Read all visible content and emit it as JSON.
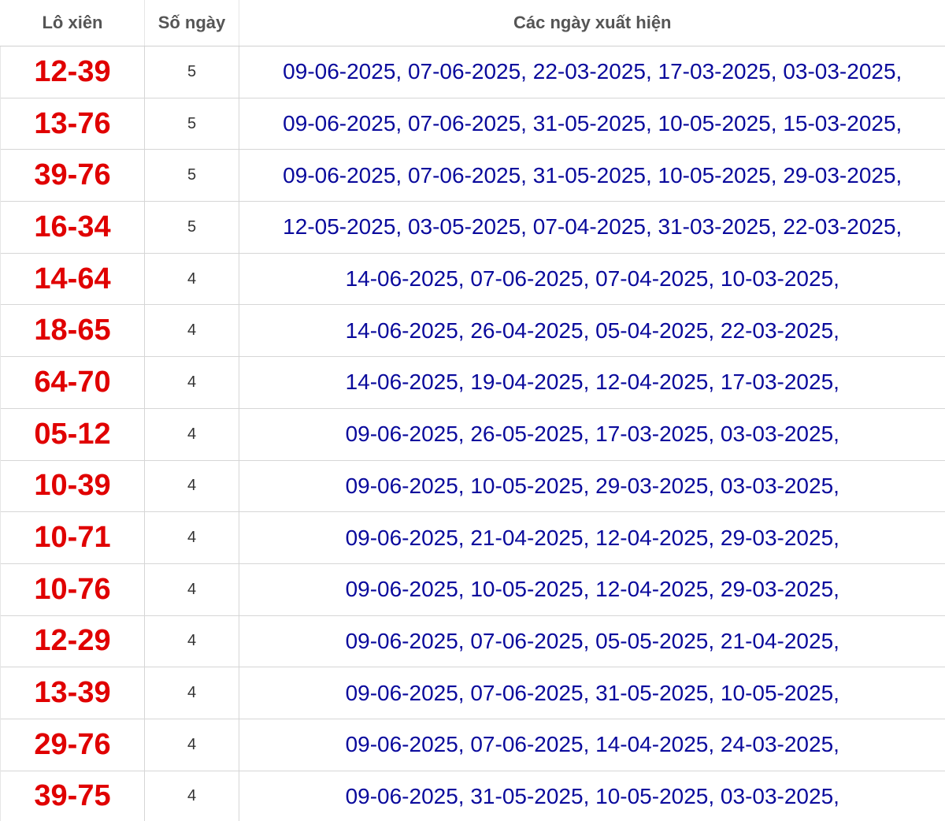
{
  "headers": {
    "pair": "Lô xiên",
    "count": "Số ngày",
    "dates": "Các ngày xuất hiện"
  },
  "colors": {
    "pair_text": "#e00000",
    "dates_text": "#0a0a9c",
    "header_text": "#555555"
  },
  "rows": [
    {
      "pair": "12-39",
      "count": "5",
      "dates": "09-06-2025, 07-06-2025, 22-03-2025, 17-03-2025, 03-03-2025,"
    },
    {
      "pair": "13-76",
      "count": "5",
      "dates": "09-06-2025, 07-06-2025, 31-05-2025, 10-05-2025, 15-03-2025,"
    },
    {
      "pair": "39-76",
      "count": "5",
      "dates": "09-06-2025, 07-06-2025, 31-05-2025, 10-05-2025, 29-03-2025,"
    },
    {
      "pair": "16-34",
      "count": "5",
      "dates": "12-05-2025, 03-05-2025, 07-04-2025, 31-03-2025, 22-03-2025,"
    },
    {
      "pair": "14-64",
      "count": "4",
      "dates": "14-06-2025, 07-06-2025, 07-04-2025, 10-03-2025,"
    },
    {
      "pair": "18-65",
      "count": "4",
      "dates": "14-06-2025, 26-04-2025, 05-04-2025, 22-03-2025,"
    },
    {
      "pair": "64-70",
      "count": "4",
      "dates": "14-06-2025, 19-04-2025, 12-04-2025, 17-03-2025,"
    },
    {
      "pair": "05-12",
      "count": "4",
      "dates": "09-06-2025, 26-05-2025, 17-03-2025, 03-03-2025,"
    },
    {
      "pair": "10-39",
      "count": "4",
      "dates": "09-06-2025, 10-05-2025, 29-03-2025, 03-03-2025,"
    },
    {
      "pair": "10-71",
      "count": "4",
      "dates": "09-06-2025, 21-04-2025, 12-04-2025, 29-03-2025,"
    },
    {
      "pair": "10-76",
      "count": "4",
      "dates": "09-06-2025, 10-05-2025, 12-04-2025, 29-03-2025,"
    },
    {
      "pair": "12-29",
      "count": "4",
      "dates": "09-06-2025, 07-06-2025, 05-05-2025, 21-04-2025,"
    },
    {
      "pair": "13-39",
      "count": "4",
      "dates": "09-06-2025, 07-06-2025, 31-05-2025, 10-05-2025,"
    },
    {
      "pair": "29-76",
      "count": "4",
      "dates": "09-06-2025, 07-06-2025, 14-04-2025, 24-03-2025,"
    },
    {
      "pair": "39-75",
      "count": "4",
      "dates": "09-06-2025, 31-05-2025, 10-05-2025, 03-03-2025,"
    }
  ]
}
